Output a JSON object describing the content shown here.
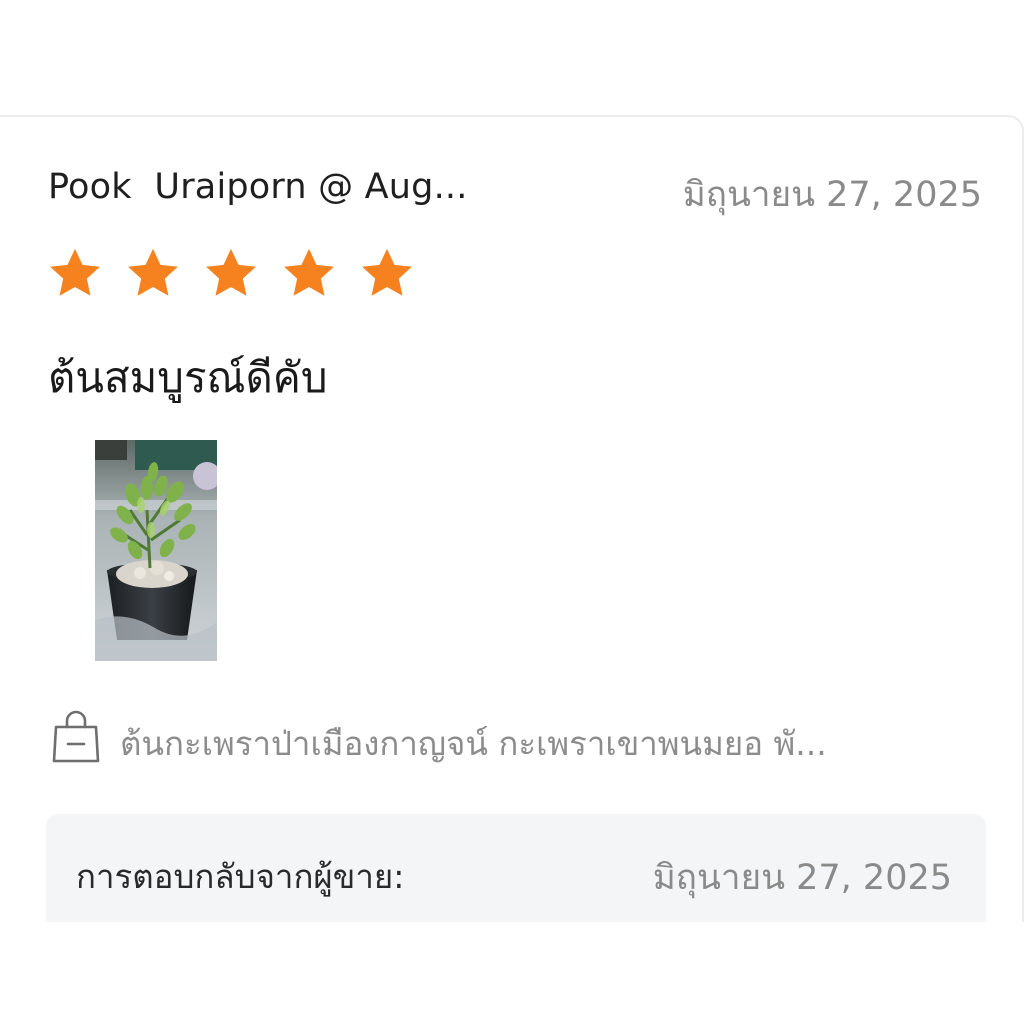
{
  "review": {
    "reviewer_name": "Pook  Uraiporn @ Aug...",
    "date": "มิถุนายน 27, 2025",
    "rating": 5,
    "rating_max": 5,
    "text": "ต้นสมบูรณ์ดีคับ",
    "photo_icon": "plant-photo"
  },
  "product": {
    "icon": "shopping-bag-icon",
    "name": "ต้นกะเพราป่าเมืองกาญจน์ กะเพราเขาพนมยอ พั..."
  },
  "seller_reply": {
    "label": "การตอบกลับจากผู้ขาย:",
    "date": "มิถุนายน 27, 2025"
  },
  "colors": {
    "star": "#f5821f",
    "reply_background": "#f4f5f7",
    "muted_text": "#8a8a8a"
  }
}
